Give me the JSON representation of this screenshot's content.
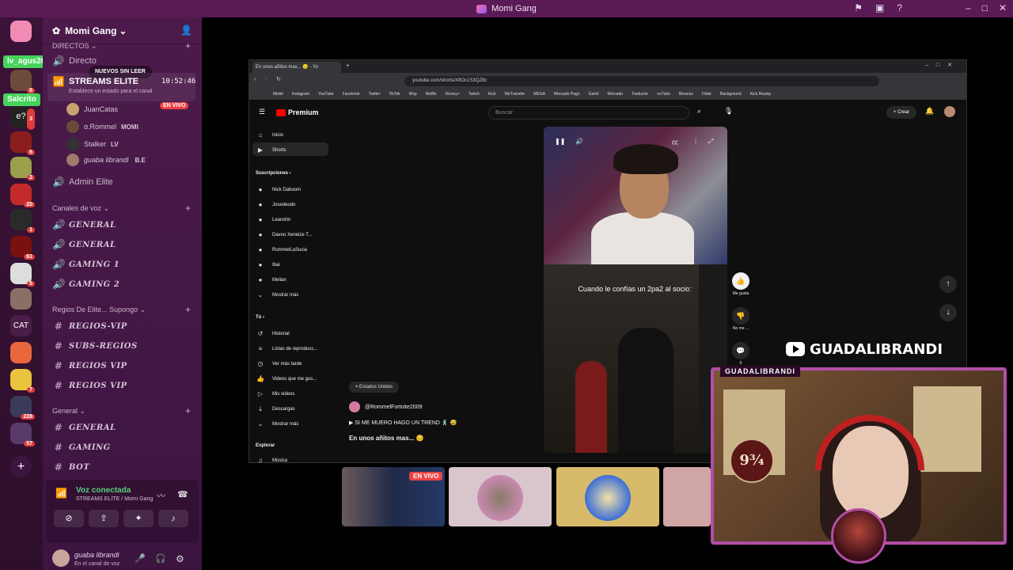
{
  "window": {
    "title": "Momi Gang"
  },
  "rail": {
    "tags": [
      "lv_agus20xx",
      "Salcrito"
    ],
    "servers": [
      {
        "badge": ""
      },
      {
        "badge": "8"
      },
      {
        "badge": "3"
      },
      {
        "badge": "6"
      },
      {
        "badge": "2"
      },
      {
        "badge": "20"
      },
      {
        "badge": "1"
      },
      {
        "badge": "61"
      },
      {
        "badge": "5"
      },
      {
        "badge": ""
      },
      {
        "label": "CAT",
        "badge": ""
      },
      {
        "badge": ""
      },
      {
        "badge": "7"
      },
      {
        "badge": "228"
      },
      {
        "badge": "57"
      }
    ],
    "cat_label": "CAT"
  },
  "sidebar": {
    "guild_name": "Momi Gang",
    "directos_cat": "DIRECTOS",
    "new_unread": "NUEVOS SIN LEER",
    "directo_label": "Directo",
    "active_channel": {
      "name": "STREAMS ELITE",
      "time": "10:52:46",
      "status": "Establece un estado para el canal"
    },
    "voice_users": [
      {
        "name": "JuanCatas",
        "tag": "",
        "live": "EN VIVO"
      },
      {
        "name": "ɑ.Rommel",
        "tag": "MOMI"
      },
      {
        "name": "Stalker",
        "tag": "LV"
      },
      {
        "name": "guaba librandi",
        "tag": "B.E"
      }
    ],
    "admin_channel": "Admin Elite",
    "voice_cat": "Canales de voz",
    "voice_channels": [
      "GENERAL",
      "GENERAL",
      "GAMING 1",
      "GAMING 2"
    ],
    "regios_cat": "Regios De Elite... Supongo",
    "regios_channels": [
      "REGIOS-VIP",
      "SUBS-REGIOS",
      "REGIOS VIP",
      "REGIOS VIP"
    ],
    "general_cat": "General",
    "general_channels": [
      "GENERAL",
      "GAMING",
      "BOT"
    ],
    "voice_connected": "Voz conectada",
    "voice_connected_sub": "STREAMS ELITE / Momi Gang",
    "user_name": "guaba librandi",
    "user_status": "En el canal de voz"
  },
  "browser": {
    "tab_title": "En unos añitos mas... 😔 - Yo",
    "url": "youtube.com/shorts/X8Oc1S3QZ8c",
    "bookmarks": [
      "Mixkit",
      "Instagram",
      "YouTube",
      "Facebook",
      "Twitter",
      "TikTok",
      "Wsp",
      "Netflix",
      "Disney+",
      "Twitch",
      "Kick",
      "WeTransfer",
      "MEGA",
      "Mercado Pago",
      "Gamil",
      "Mercado",
      "Traductor",
      "noTube",
      "Binance",
      "Dólar",
      "Background",
      "Kick Replay"
    ],
    "yt_brand": "Premium",
    "search_placeholder": "Buscar",
    "create_label": "Crear",
    "nav": {
      "inicio": "Inicio",
      "shorts": "Shorts",
      "subs_title": "Suscripciones",
      "subs": [
        "Nick Daboom",
        "Josedeodo",
        "Leandrin",
        "Davoo Xeneize T...",
        "RommelLaSucia",
        "Ibai",
        "Mellan"
      ],
      "mostrar_mas": "Mostrar más",
      "tu": "Tú",
      "tu_items": [
        "Historial",
        "Listas de reproducc...",
        "Ver más tarde",
        "Videos que me gus...",
        "Mis videos",
        "Descargas",
        "Mostrar más"
      ],
      "explorar": "Explorar",
      "musica": "Música"
    },
    "short": {
      "caption": "Cuando le confías un 2pa2 al socio:",
      "location": "Estados Unidos",
      "channel": "@RommelFortnite2009",
      "song": "SI ME MUERO HAGO UN TREND 🕺 😅",
      "title": "En unos añitos mas... 😔",
      "like_label": "Me gusta",
      "dislike_label": "No me ...",
      "comments_count": "0"
    }
  },
  "thumbs": {
    "live_tag": "EN VIVO"
  },
  "streamer": {
    "handle": "GUADALIBRANDI",
    "cam_label": "GUADALIBRANDI",
    "platform_text": "9¾"
  }
}
